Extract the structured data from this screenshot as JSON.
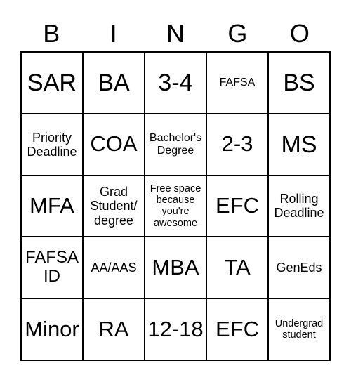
{
  "header": [
    "B",
    "I",
    "N",
    "G",
    "O"
  ],
  "cells": [
    [
      "SAR",
      "BA",
      "3-4",
      "FAFSA",
      "BS"
    ],
    [
      "Priority Deadline",
      "COA",
      "Bachelor's Degree",
      "2-3",
      "MS"
    ],
    [
      "MFA",
      "Grad Student/ degree",
      "Free space because you're awesome",
      "EFC",
      "Rolling Deadline"
    ],
    [
      "FAFSA ID",
      "AA/AAS",
      "MBA",
      "TA",
      "GenEds"
    ],
    [
      "Minor",
      "RA",
      "12-18",
      "EFC",
      "Undergrad student"
    ]
  ]
}
